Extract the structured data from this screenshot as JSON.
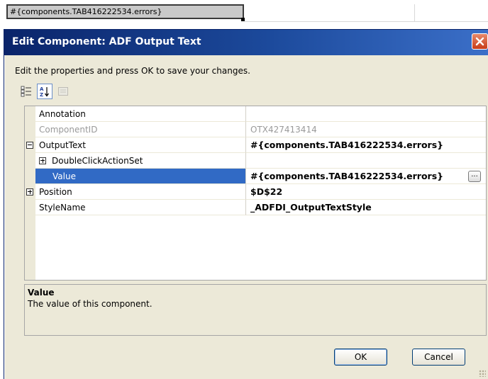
{
  "spreadsheet": {
    "cell_value": "#{components.TAB416222534.errors}"
  },
  "dialog": {
    "title": "Edit Component: ADF Output Text",
    "instructions": "Edit the properties and press OK to save your changes."
  },
  "toolbar": {
    "categorized_icon": "categorized-icon",
    "alphabetical_icon": "sort-alphabetical-icon",
    "property_pages_icon": "property-pages-icon"
  },
  "properties": [
    {
      "name": "Annotation",
      "value": ""
    },
    {
      "name": "ComponentID",
      "value": "OTX427413414"
    },
    {
      "name": "OutputText",
      "value": "#{components.TAB416222534.errors}"
    },
    {
      "name": "DoubleClickActionSet",
      "value": ""
    },
    {
      "name": "Value",
      "value": "#{components.TAB416222534.errors}",
      "button": "..."
    },
    {
      "name": "Position",
      "value": "$D$22"
    },
    {
      "name": "StyleName",
      "value": "_ADFDI_OutputTextStyle"
    }
  ],
  "description": {
    "title": "Value",
    "text": "The value of this component."
  },
  "buttons": {
    "ok": "OK",
    "cancel": "Cancel"
  },
  "colors": {
    "titlebar": "#0a246a",
    "selection": "#316ac5",
    "dialog_bg": "#ece9d8"
  }
}
